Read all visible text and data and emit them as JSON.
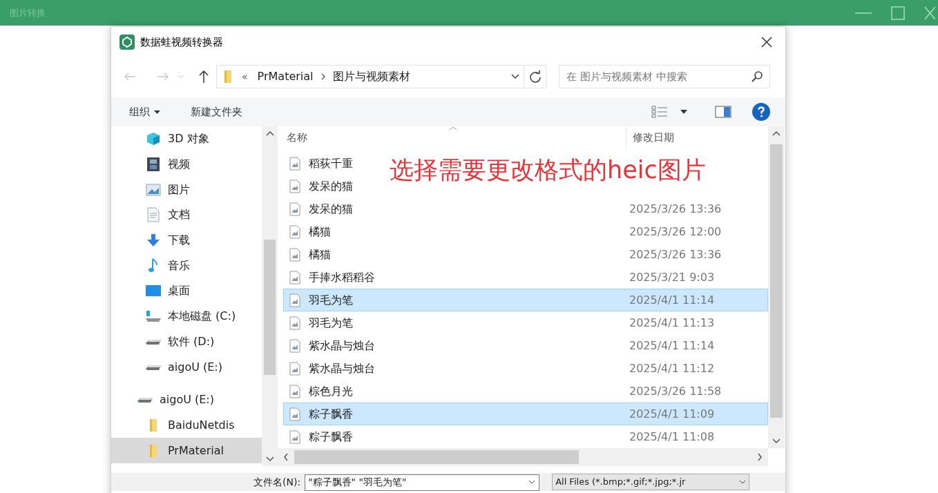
{
  "app": {
    "title": "图片转换"
  },
  "dialog": {
    "title": "数据蛙视频转换器"
  },
  "address_bar": {
    "overflow": "«",
    "path": [
      "PrMaterial",
      "图片与视频素材"
    ]
  },
  "search": {
    "placeholder": "在 图片与视频素材 中搜索"
  },
  "toolbar": {
    "organize": "组织",
    "new_folder": "新建文件夹"
  },
  "sidebar": {
    "sections": [
      {
        "items": [
          {
            "label": "3D 对象",
            "kind": "cube",
            "selected": false
          },
          {
            "label": "视频",
            "kind": "video",
            "selected": false
          },
          {
            "label": "图片",
            "kind": "image",
            "selected": false
          },
          {
            "label": "文档",
            "kind": "document",
            "selected": false
          },
          {
            "label": "下载",
            "kind": "download",
            "selected": false
          },
          {
            "label": "音乐",
            "kind": "music",
            "selected": false
          },
          {
            "label": "桌面",
            "kind": "desktop",
            "selected": false
          },
          {
            "label": "本地磁盘 (C:)",
            "kind": "system-drive",
            "selected": false
          },
          {
            "label": "软件 (D:)",
            "kind": "drive",
            "selected": false
          },
          {
            "label": "aigoU (E:)",
            "kind": "drive",
            "selected": false
          }
        ]
      },
      {
        "items": [
          {
            "label": "aigoU (E:)",
            "kind": "drive",
            "selected": false,
            "children": [
              {
                "label": "BaiduNetdis",
                "kind": "folder",
                "selected": false
              },
              {
                "label": "PrMaterial",
                "kind": "folder",
                "selected": true
              }
            ]
          }
        ]
      }
    ]
  },
  "file_list": {
    "columns": [
      "名称",
      "修改日期"
    ],
    "rows": [
      {
        "name": "稻荻千重",
        "selected": false
      },
      {
        "name": "发呆的猫",
        "selected": false
      },
      {
        "name": "发呆的猫",
        "date": "2025/3/26 13:36",
        "selected": false
      },
      {
        "name": "橘猫",
        "date": "2025/3/26 12:00",
        "selected": false
      },
      {
        "name": "橘猫",
        "date": "2025/3/26 13:36",
        "selected": false
      },
      {
        "name": "手捧水稻稻谷",
        "date": "2025/3/21 9:03",
        "selected": false
      },
      {
        "name": "羽毛为笔",
        "date": "2025/4/1 11:14",
        "selected": true
      },
      {
        "name": "羽毛为笔",
        "date": "2025/4/1 11:13",
        "selected": false
      },
      {
        "name": "紫水晶与烛台",
        "date": "2025/4/1 11:14",
        "selected": false
      },
      {
        "name": "紫水晶与烛台",
        "date": "2025/4/1 11:12",
        "selected": false
      },
      {
        "name": "棕色月光",
        "date": "2025/3/26 11:58",
        "selected": false
      },
      {
        "name": "粽子飘香",
        "date": "2025/4/1 11:09",
        "selected": true
      },
      {
        "name": "粽子飘香",
        "date": "2025/4/1 11:08",
        "selected": false
      }
    ]
  },
  "annotation": {
    "text": "选择需要更改格式的heic图片"
  },
  "file_name": {
    "label": "文件名(N):",
    "value": "\"粽子飘香\" \"羽毛为笔\""
  },
  "file_type": {
    "value": "All Files (*.bmp;*.gif;*.jpg;*.jr"
  }
}
